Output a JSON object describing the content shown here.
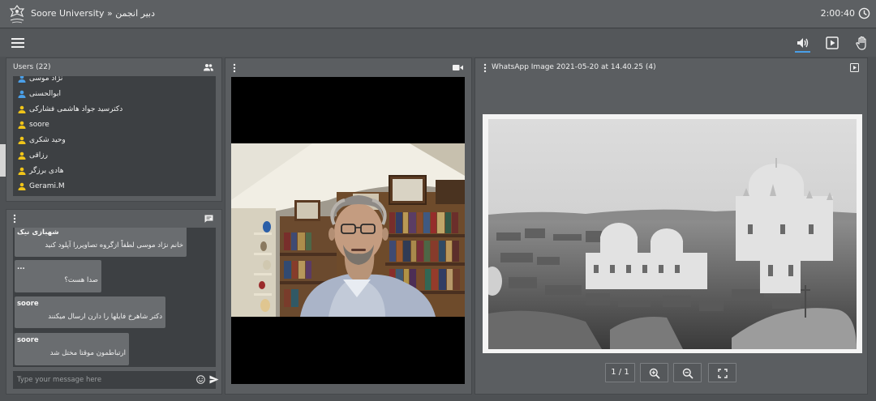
{
  "app": {
    "title": "Soore University » دبیر انجمن",
    "timer": "2:00:40"
  },
  "users": {
    "title": "Users (22)",
    "items": [
      {
        "name": "نژاد موسی",
        "color": "#4a9fe8"
      },
      {
        "name": "ابوالحسنی",
        "color": "#4a9fe8"
      },
      {
        "name": "دکترسید جواد هاشمی فشارکی",
        "color": "#f0c419"
      },
      {
        "name": "soore",
        "color": "#f0c419"
      },
      {
        "name": "وحید شکری",
        "color": "#f0c419"
      },
      {
        "name": "رزاقی",
        "color": "#f0c419"
      },
      {
        "name": "هادی برزگر",
        "color": "#f0c419"
      },
      {
        "name": "Gerami.M",
        "color": "#f0c419"
      }
    ]
  },
  "chat": {
    "messages": [
      {
        "sender": "شهبازی نیک",
        "text": "خانم نژاد موسی لطفاً ازگروه تصاویررا آپلود کنید"
      },
      {
        "sender": "...",
        "text": "صدا هست؟"
      },
      {
        "sender": "soore",
        "text": "دکتر شاهرخ فایلها را دارن ارسال میکنند"
      },
      {
        "sender": "soore",
        "text": "ارتباطمون موقتا مختل شد"
      }
    ],
    "placeholder": "Type your message here"
  },
  "presentation": {
    "title": "WhatsApp Image 2021-05-20 at 14.40.25 (4)",
    "page": "1 / 1"
  },
  "colors": {
    "accent": "#4a9fe8",
    "presenter": "#f0c419"
  }
}
